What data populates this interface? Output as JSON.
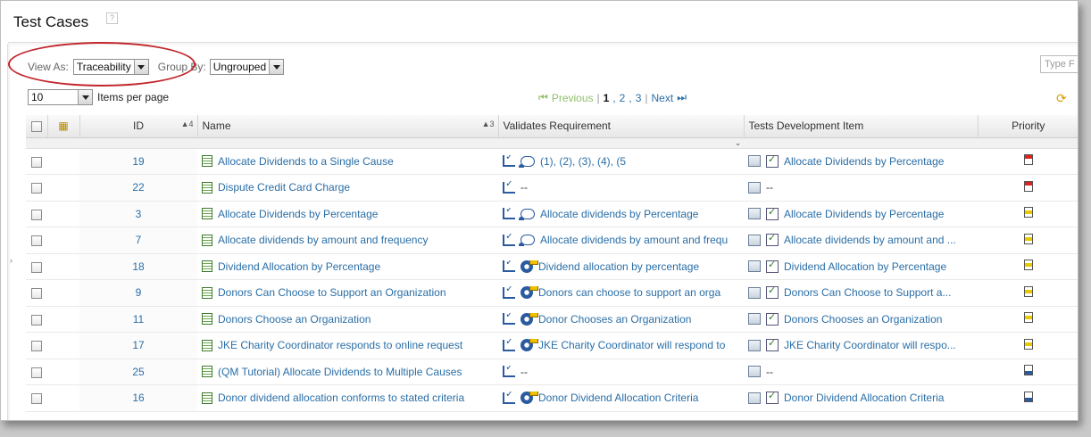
{
  "page": {
    "title": "Test Cases",
    "help_label": "?"
  },
  "toolbar": {
    "view_as_label": "View As:",
    "view_as_value": "Traceability",
    "group_by_label": "Group By:",
    "group_by_value": "Ungrouped",
    "type_filter_placeholder": "Type F"
  },
  "pagination": {
    "page_size": "10",
    "items_per_page_label": "Items per page",
    "previous": "Previous",
    "pages": [
      "1",
      "2",
      "3"
    ],
    "current_page": "1",
    "next": "Next"
  },
  "columns": {
    "id": "ID",
    "id_sort": "▲4",
    "name": "Name",
    "name_sort": "▲3",
    "validates": "Validates Requirement",
    "tests_dev": "Tests Development Item",
    "priority": "Priority"
  },
  "rows": [
    {
      "id": "19",
      "name": "Allocate Dividends to a Single Cause",
      "req": "(1), (2), (3), (4), (5",
      "req_kind": "multi",
      "dev": "Allocate Dividends by Percentage",
      "priority": "high"
    },
    {
      "id": "22",
      "name": "Dispute Credit Card Charge",
      "req": "--",
      "req_kind": "none",
      "dev": "--",
      "priority": "high"
    },
    {
      "id": "3",
      "name": "Allocate Dividends by Percentage",
      "req": "Allocate dividends by Percentage",
      "req_kind": "req",
      "dev": "Allocate Dividends by Percentage",
      "priority": "med"
    },
    {
      "id": "7",
      "name": "Allocate dividends by amount and frequency",
      "req": "Allocate dividends by amount and frequ",
      "req_kind": "req",
      "dev": "Allocate dividends by amount and ...",
      "priority": "med"
    },
    {
      "id": "18",
      "name": "Dividend Allocation by Percentage",
      "req": "Dividend allocation by percentage",
      "req_kind": "gear",
      "dev": "Dividend Allocation by Percentage",
      "priority": "med"
    },
    {
      "id": "9",
      "name": "Donors Can Choose to Support an Organization",
      "req": "Donors can choose to support an orga",
      "req_kind": "gear",
      "dev": "Donors Can Choose to Support a...",
      "priority": "med"
    },
    {
      "id": "11",
      "name": "Donors Choose an Organization",
      "req": "Donor Chooses an Organization",
      "req_kind": "gear",
      "dev": "Donors Chooses an Organization",
      "priority": "med"
    },
    {
      "id": "17",
      "name": "JKE Charity Coordinator responds to online request",
      "req": "JKE Charity Coordinator will respond to",
      "req_kind": "gear",
      "dev": "JKE Charity Coordinator will respo...",
      "priority": "med"
    },
    {
      "id": "25",
      "name": "(QM Tutorial) Allocate Dividends to Multiple Causes",
      "req": "--",
      "req_kind": "none",
      "dev": "--",
      "priority": "low"
    },
    {
      "id": "16",
      "name": "Donor dividend allocation conforms to stated criteria",
      "req": "Donor Dividend Allocation Criteria",
      "req_kind": "gear",
      "dev": "Donor Dividend Allocation Criteria",
      "priority": "low"
    }
  ],
  "colors": {
    "link": "#2a6ea6",
    "annotation_ellipse": "#c1272d"
  }
}
